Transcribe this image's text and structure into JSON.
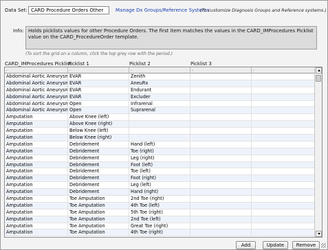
{
  "dataset": {
    "label": "Data Set:",
    "value": "CARD Procedure Orders Other"
  },
  "manage": {
    "link_text": "Manage Dx Groups/Reference Systems",
    "note": "(To customize Diagnosis Groups and Reference systems.)"
  },
  "info": {
    "label": "Info:",
    "text": "Holds picklists values for other Procedure Orders.  The first item matches the values in the CARD_IMProcedures Picklist value on the CARD_ProcedureOrder template."
  },
  "sort_note": "(To sort the grid on a column, click the top grey row with the period.)",
  "grid": {
    "headers": [
      "CARD_IMProcedures Picklist",
      "Picklist 1",
      "Picklist 2",
      "Picklist 3"
    ],
    "filter_values": [
      ".",
      ".",
      ".",
      ".",
      "."
    ],
    "rows": [
      [
        "Abdominal Aortic Aneurysm",
        "EVAR",
        "Zenith"
      ],
      [
        "Abdominal Aortic Aneurysm",
        "EVAR",
        "AneuRx"
      ],
      [
        "Abdominal Aortic Aneurysm",
        "EVAR",
        "Endurant"
      ],
      [
        "Abdominal Aortic Aneurysm",
        "EVAR",
        "Excluder"
      ],
      [
        "Abdominal Aortic Aneurysm",
        "Open",
        "Infrarenal"
      ],
      [
        "Abdominal Aortic Aneurysm",
        "Open",
        "Suprarenal"
      ],
      [
        "Amputation",
        "Above Knee (left)",
        ""
      ],
      [
        "Amputation",
        "Above Knee (right)",
        ""
      ],
      [
        "Amputation",
        "Below Knee (left)",
        ""
      ],
      [
        "Amputation",
        "Below Knee (right)",
        ""
      ],
      [
        "Amputation",
        "Debridement",
        "Hand (left)"
      ],
      [
        "Amputation",
        "Debridement",
        "Toe (right)"
      ],
      [
        "Amputation",
        "Debridement",
        "Leg (right)"
      ],
      [
        "Amputation",
        "Debridement",
        "Foot (left)"
      ],
      [
        "Amputation",
        "Debridement",
        "Toe (left)"
      ],
      [
        "Amputation",
        "Debridement",
        "Foot (right)"
      ],
      [
        "Amputation",
        "Debridement",
        "Leg (left)"
      ],
      [
        "Amputation",
        "Debridement",
        "Hand (right)"
      ],
      [
        "Amputation",
        "Toe Amputation",
        "2nd Toe (right)"
      ],
      [
        "Amputation",
        "Toe Amputation",
        "4th Toe (left)"
      ],
      [
        "Amputation",
        "Toe Amputation",
        "5th Toe (right)"
      ],
      [
        "Amputation",
        "Toe Amputation",
        "2nd Toe (left)"
      ],
      [
        "Amputation",
        "Toe Amputation",
        "Great Toe (right)"
      ],
      [
        "Amputation",
        "Toe Amputation",
        "4th Toe (right)"
      ]
    ]
  },
  "buttons": {
    "add": "Add",
    "update": "Update",
    "remove": "Remove"
  }
}
